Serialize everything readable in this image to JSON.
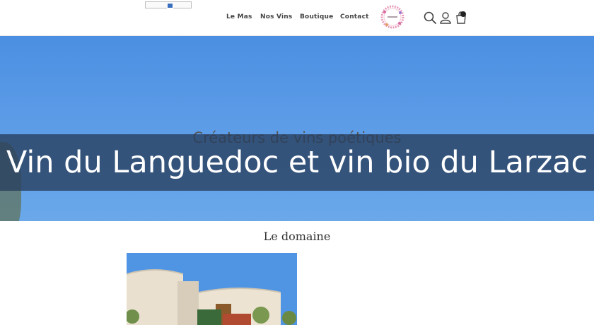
{
  "header": {
    "nav": [
      "Le Mas",
      "Nos Vins",
      "Boutique",
      "Contact"
    ],
    "icons": [
      "search-icon",
      "user-icon",
      "cart-icon"
    ]
  },
  "hero": {
    "title": "Vin du Languedoc et vin bio du Larzac",
    "subtitle": "Créateurs de vins poétiques"
  },
  "section": {
    "title": "Le domaine"
  },
  "colors": {
    "sky": "#5a9ae6",
    "band": "#283e5c",
    "nav_text": "#444444"
  }
}
